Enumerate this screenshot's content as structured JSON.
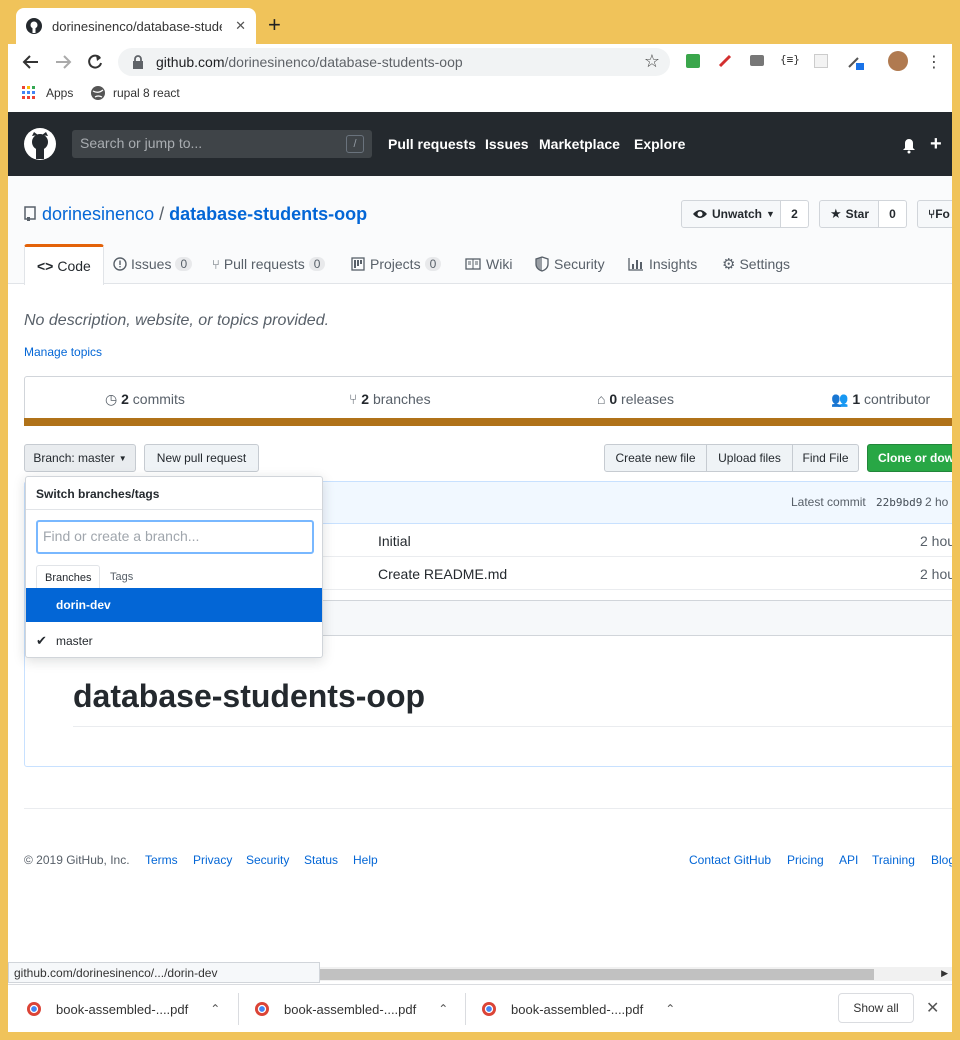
{
  "browser": {
    "tab_title": "dorinesinenco/database-students-oop",
    "url_host": "github.com",
    "url_path": "/dorinesinenco/database-students-oop",
    "bookmarks": [
      "Apps",
      "rupal 8 react"
    ],
    "status_url": "github.com/dorinesinenco/.../dorin-dev"
  },
  "header": {
    "search_placeholder": "Search or jump to...",
    "slash": "/",
    "nav": [
      "Pull requests",
      "Issues",
      "Marketplace",
      "Explore"
    ]
  },
  "repo": {
    "owner": "dorinesinenco",
    "separator": "/",
    "name": "database-students-oop",
    "watch_label": "Unwatch",
    "watch_count": "2",
    "star_label": "Star",
    "star_count": "0",
    "fork_label": "Fo"
  },
  "tabs": [
    {
      "label": "Code"
    },
    {
      "label": "Issues",
      "count": "0"
    },
    {
      "label": "Pull requests",
      "count": "0"
    },
    {
      "label": "Projects",
      "count": "0"
    },
    {
      "label": "Wiki"
    },
    {
      "label": "Security"
    },
    {
      "label": "Insights"
    },
    {
      "label": "Settings"
    }
  ],
  "description": "No description, website, or topics provided.",
  "manage_topics": "Manage topics",
  "summary": {
    "commits_n": "2",
    "commits_label": "commits",
    "branches_n": "2",
    "branches_label": "branches",
    "releases_n": "0",
    "releases_label": "releases",
    "contributors_n": "1",
    "contributors_label": "contributor"
  },
  "filebar": {
    "branch_label": "Branch: master",
    "new_pr": "New pull request",
    "create_file": "Create new file",
    "upload_files": "Upload files",
    "find_file": "Find File",
    "clone": "Clone or dow"
  },
  "commit": {
    "latest_label": "Latest commit",
    "sha": "22b9bd9",
    "time": "2 ho"
  },
  "files": [
    {
      "message": "Initial",
      "age": "2 hou"
    },
    {
      "message": "Create README.md",
      "age": "2 hou"
    }
  ],
  "readme_title": "database-students-oop",
  "dropdown": {
    "header": "Switch branches/tags",
    "input_placeholder": "Find or create a branch...",
    "tab_branches": "Branches",
    "tab_tags": "Tags",
    "items": [
      "dorin-dev",
      "master"
    ]
  },
  "footer": {
    "copyright": "© 2019 GitHub, Inc.",
    "left_links": [
      "Terms",
      "Privacy",
      "Security",
      "Status",
      "Help"
    ],
    "right_links": [
      "Contact GitHub",
      "Pricing",
      "API",
      "Training",
      "Blog"
    ]
  },
  "downloads": {
    "files": [
      "book-assembled-....pdf",
      "book-assembled-....pdf",
      "book-assembled-....pdf"
    ],
    "show_all": "Show all"
  },
  "colors": {
    "window_frame": "#f0c35a",
    "header_bg": "#24292e",
    "link": "#0366d6",
    "language_bar": "#b07219",
    "clone_green": "#28a745",
    "tab_accent": "#e36209"
  }
}
